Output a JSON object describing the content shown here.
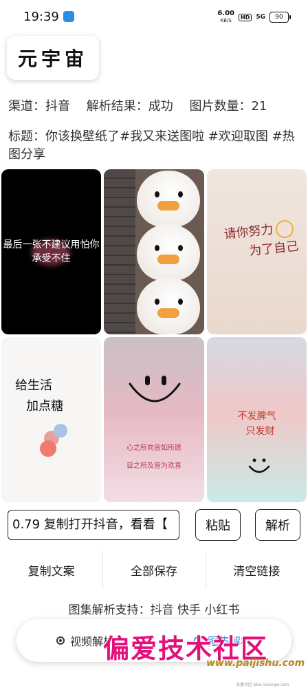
{
  "status_bar": {
    "time": "19:39",
    "net_speed": "6.00",
    "net_unit": "KB/S",
    "hd": "HD",
    "signal": "5G",
    "battery": "90"
  },
  "app": {
    "title": "元宇宙"
  },
  "result": {
    "channel_label": "渠道：抖音",
    "status_label": "解析结果：成功",
    "count_label": "图片数量：21",
    "caption": "标题：你该换壁纸了#我又来送图啦 #欢迎取图 #热图分享"
  },
  "images": {
    "img1_text": "最后一张不建议用怕你承受不住",
    "img3_text_a": "请你努力",
    "img3_text_b": "为了自己",
    "img4_text_a": "给生活",
    "img4_text_b": "加点糖",
    "img5_line1": "心之所向皆如所愿",
    "img5_line2": "目之所及皆为欢喜",
    "img6_text_a": "不发脾气",
    "img6_text_b": "只发财"
  },
  "input": {
    "value": "0.79 复制打开抖音，看看【"
  },
  "buttons": {
    "paste": "粘贴",
    "parse": "解析"
  },
  "actions": {
    "copy_text": "复制文案",
    "save_all": "全部保存",
    "clear_link": "清空链接"
  },
  "support_text": "图集解析支持：抖音 快手 小红书",
  "bottom_nav": {
    "video": "视频解析",
    "album": "图集解析"
  },
  "watermark": {
    "text": "偏爱技术社区",
    "url": "www.paijishu.com",
    "small": "流量社区·bbs.liuxingw.com"
  }
}
